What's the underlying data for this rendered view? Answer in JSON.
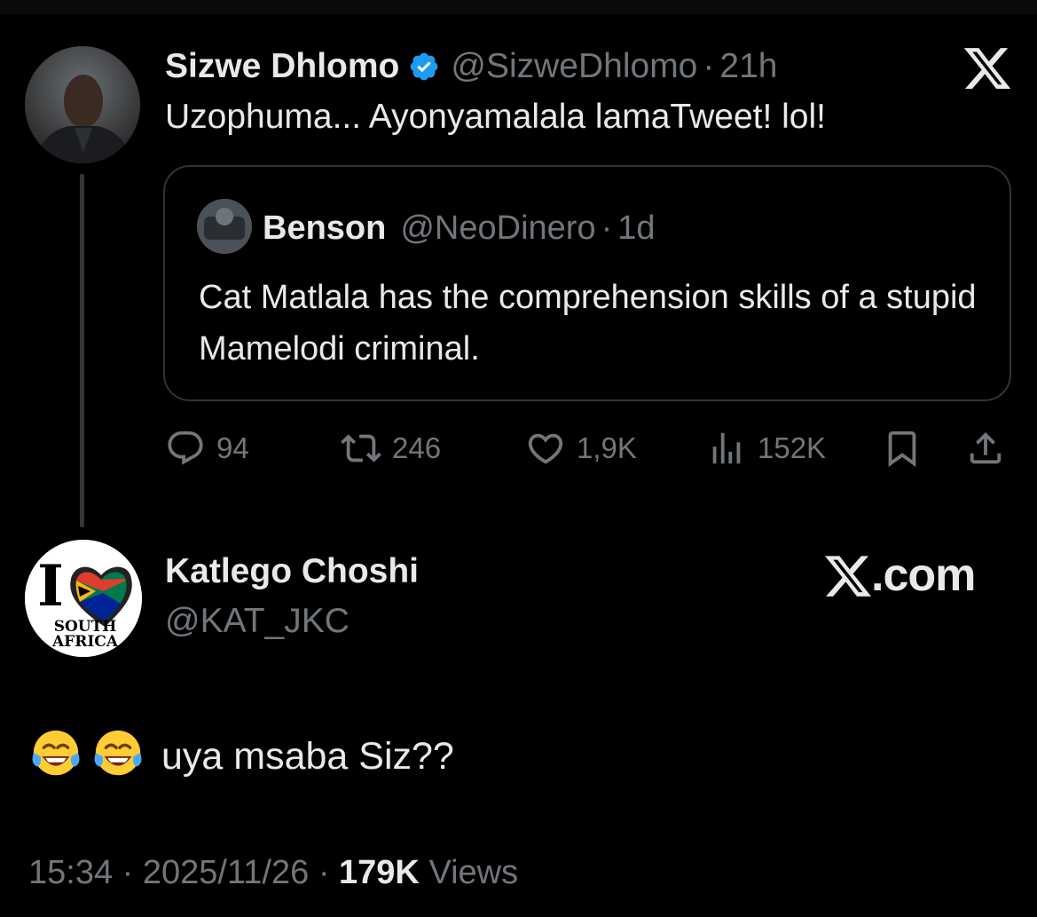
{
  "parent_tweet": {
    "author_name": "Sizwe Dhlomo",
    "author_handle": "@SizweDhlomo",
    "separator": "·",
    "time": "21h",
    "text": "Uzophuma... Ayonyamalala lamaTweet! lol!",
    "verified_icon": "verified-badge-icon",
    "quoted_tweet": {
      "author_name": "Benson",
      "author_handle": "@NeoDinero",
      "separator": "·",
      "time": "1d",
      "text": "Cat Matlala has the comprehension skills of a stupid Mamelodi criminal."
    },
    "actions": {
      "replies": "94",
      "reposts": "246",
      "likes": "1,9K",
      "views": "152K"
    }
  },
  "reply": {
    "author_name": "Katlego Choshi",
    "author_handle": "@KAT_JKC",
    "source_label": ".com",
    "avatar_text": {
      "line1": "SOUTH",
      "line2": "AFRICA",
      "letter": "I"
    },
    "emojis": [
      "😂",
      "😂"
    ],
    "text": "uya msaba Siz??",
    "meta": {
      "time": "15:34",
      "separator": "·",
      "date": "2025/11/26",
      "views_count": "179K",
      "views_label": "Views"
    }
  },
  "colors": {
    "background": "#000000",
    "text_primary": "#e7e9ea",
    "text_secondary": "#71767b",
    "verified": "#1d9bf0",
    "border": "#2f3336"
  }
}
